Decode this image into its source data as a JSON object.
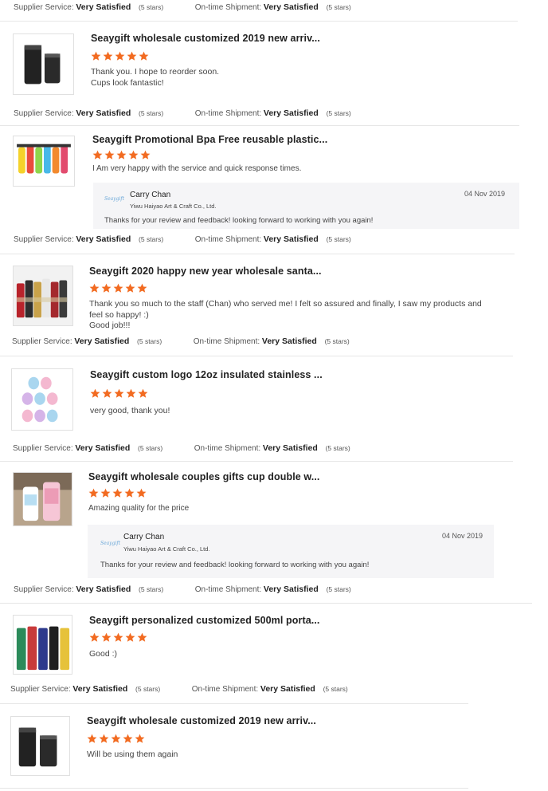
{
  "colors": {
    "star": "#f26b21",
    "divider": "#e6e6e6",
    "reply_bg": "#f5f5f7"
  },
  "labels": {
    "supplier_service": "Supplier Service:",
    "on_time_shipment": "On-time Shipment:",
    "very_satisfied": "Very Satisfied",
    "five_stars": "(5 stars)"
  },
  "reviews": [
    {
      "title": "Seaygift wholesale customized 2019 new arriv...",
      "rating": 5,
      "text": "Thank you. I hope to reorder soon.\nCups look fantastic!",
      "image_icon": "black-tumblers-image"
    },
    {
      "title": "Seaygift Promotional Bpa Free reusable plastic...",
      "rating": 5,
      "text": "I Am very happy with the service and quick response times.",
      "image_icon": "colorful-bottles-image",
      "reply": {
        "name": "Carry Chan",
        "company": "Yiwu Haiyao Art & Craft Co., Ltd.",
        "date": "04 Nov 2019",
        "text": "Thanks for your review and feedback!  looking forward to working with you again!",
        "logo_text": "Seaygift"
      }
    },
    {
      "title": "Seaygift 2020 happy new year wholesale santa...",
      "rating": 5,
      "text": "Thank you so much to the staff (Chan) who served me!    I felt so assured and finally,  I saw my products and\nfeel so happy! :)\nGood job!!!",
      "image_icon": "printed-bottles-image"
    },
    {
      "title": "Seaygift custom logo 12oz insulated stainless ...",
      "rating": 5,
      "text": "very good, thank you!",
      "image_icon": "pastel-cups-image"
    },
    {
      "title": "Seaygift wholesale couples gifts cup double w...",
      "rating": 5,
      "text": "Amazing quality for the price",
      "image_icon": "couple-cups-image",
      "reply": {
        "name": "Carry Chan",
        "company": "Yiwu Haiyao Art & Craft Co., Ltd.",
        "date": "04 Nov 2019",
        "text": "Thanks for your review and feedback!  looking forward to working with you again!",
        "logo_text": "Seaygift"
      }
    },
    {
      "title": "Seaygift personalized customized 500ml porta...",
      "rating": 5,
      "text": "Good :)",
      "image_icon": "color-flasks-image"
    },
    {
      "title": "Seaygift wholesale customized 2019 new arriv...",
      "rating": 5,
      "text": "Will be using them again",
      "image_icon": "black-tumblers-image"
    }
  ]
}
